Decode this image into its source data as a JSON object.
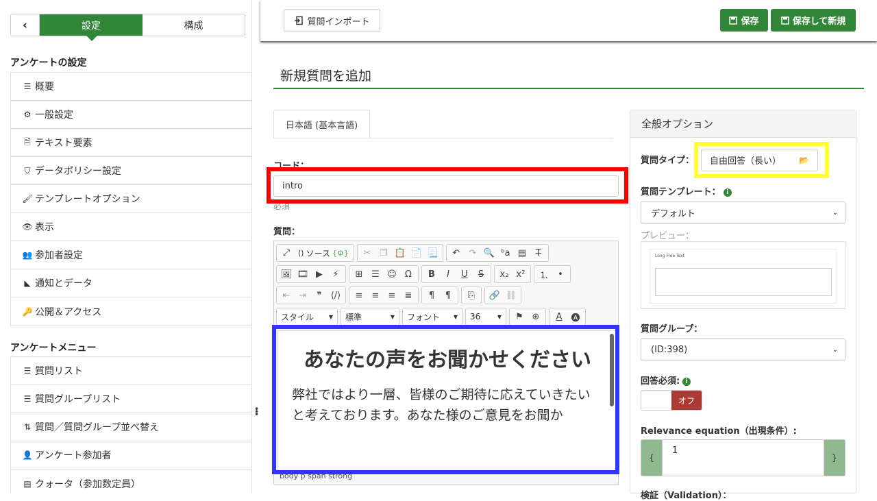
{
  "sidebar": {
    "back_glyph": "‹",
    "tab_settings": "設定",
    "tab_structure": "構成",
    "survey_settings_title": "アンケートの設定",
    "settings_items": [
      {
        "label": "概要",
        "icon": "list-icon"
      },
      {
        "label": "一般設定",
        "icon": "gears-icon"
      },
      {
        "label": "テキスト要素",
        "icon": "file-text-icon"
      },
      {
        "label": "データポリシー設定",
        "icon": "shield-icon"
      },
      {
        "label": "テンプレートオプション",
        "icon": "paintbrush-icon"
      },
      {
        "label": "表示",
        "icon": "eye-icon"
      },
      {
        "label": "参加者設定",
        "icon": "users-icon"
      },
      {
        "label": "通知とデータ",
        "icon": "rss-icon"
      },
      {
        "label": "公開＆アクセス",
        "icon": "key-icon"
      }
    ],
    "survey_menu_title": "アンケートメニュー",
    "menu_items": [
      {
        "label": "質問リスト",
        "icon": "list-icon"
      },
      {
        "label": "質問グループリスト",
        "icon": "list-icon"
      },
      {
        "label": "質問／質問グループ並べ替え",
        "icon": "sort-icon"
      },
      {
        "label": "アンケート参加者",
        "icon": "user-icon"
      },
      {
        "label": "クォータ（参加数定員）",
        "icon": "tasks-icon"
      }
    ]
  },
  "toolbar": {
    "import_label": "質問インポート",
    "save_label": "保存",
    "save_new_label": "保存して新規"
  },
  "main": {
    "page_title": "新規質問を追加",
    "language_tab": "日本語 (基本言語)",
    "code_label": "コード：",
    "code_value": "intro",
    "required_note": "必須",
    "question_label": "質問：",
    "editor": {
      "source_label": "ソース",
      "combo_style": "スタイル",
      "combo_format": "標準",
      "combo_font": "フォント",
      "combo_size": "36",
      "heading": "あなたの声をお聞かせください",
      "paragraph": "弊社ではより一層、皆様のご期待に応えていきたいと考えております。あなた様のご意見をお聞か",
      "status_path": "body   p   span   strong"
    }
  },
  "options": {
    "panel_title": "全般オプション",
    "question_type_label": "質問タイプ：",
    "question_type_value": "自由回答（長い）",
    "template_label": "質問テンプレート：",
    "template_value": "デフォルト",
    "preview_label": "プレビュー：",
    "preview_text": "Long Free Text",
    "group_label": "質問グループ：",
    "group_value": "(ID:398)",
    "mandatory_label": "回答必須:",
    "mandatory_value": "オフ",
    "relevance_label": "Relevance equation（出現条件）:",
    "relevance_value": "1",
    "relevance_open": "{",
    "relevance_close": "}",
    "validation_label": "検証（Validation）："
  },
  "colors": {
    "brand_green": "#328637",
    "off_red": "#a93a34",
    "highlight_red": "#ff0000",
    "highlight_yellow": "#ffff33",
    "highlight_blue": "#3333ff"
  }
}
